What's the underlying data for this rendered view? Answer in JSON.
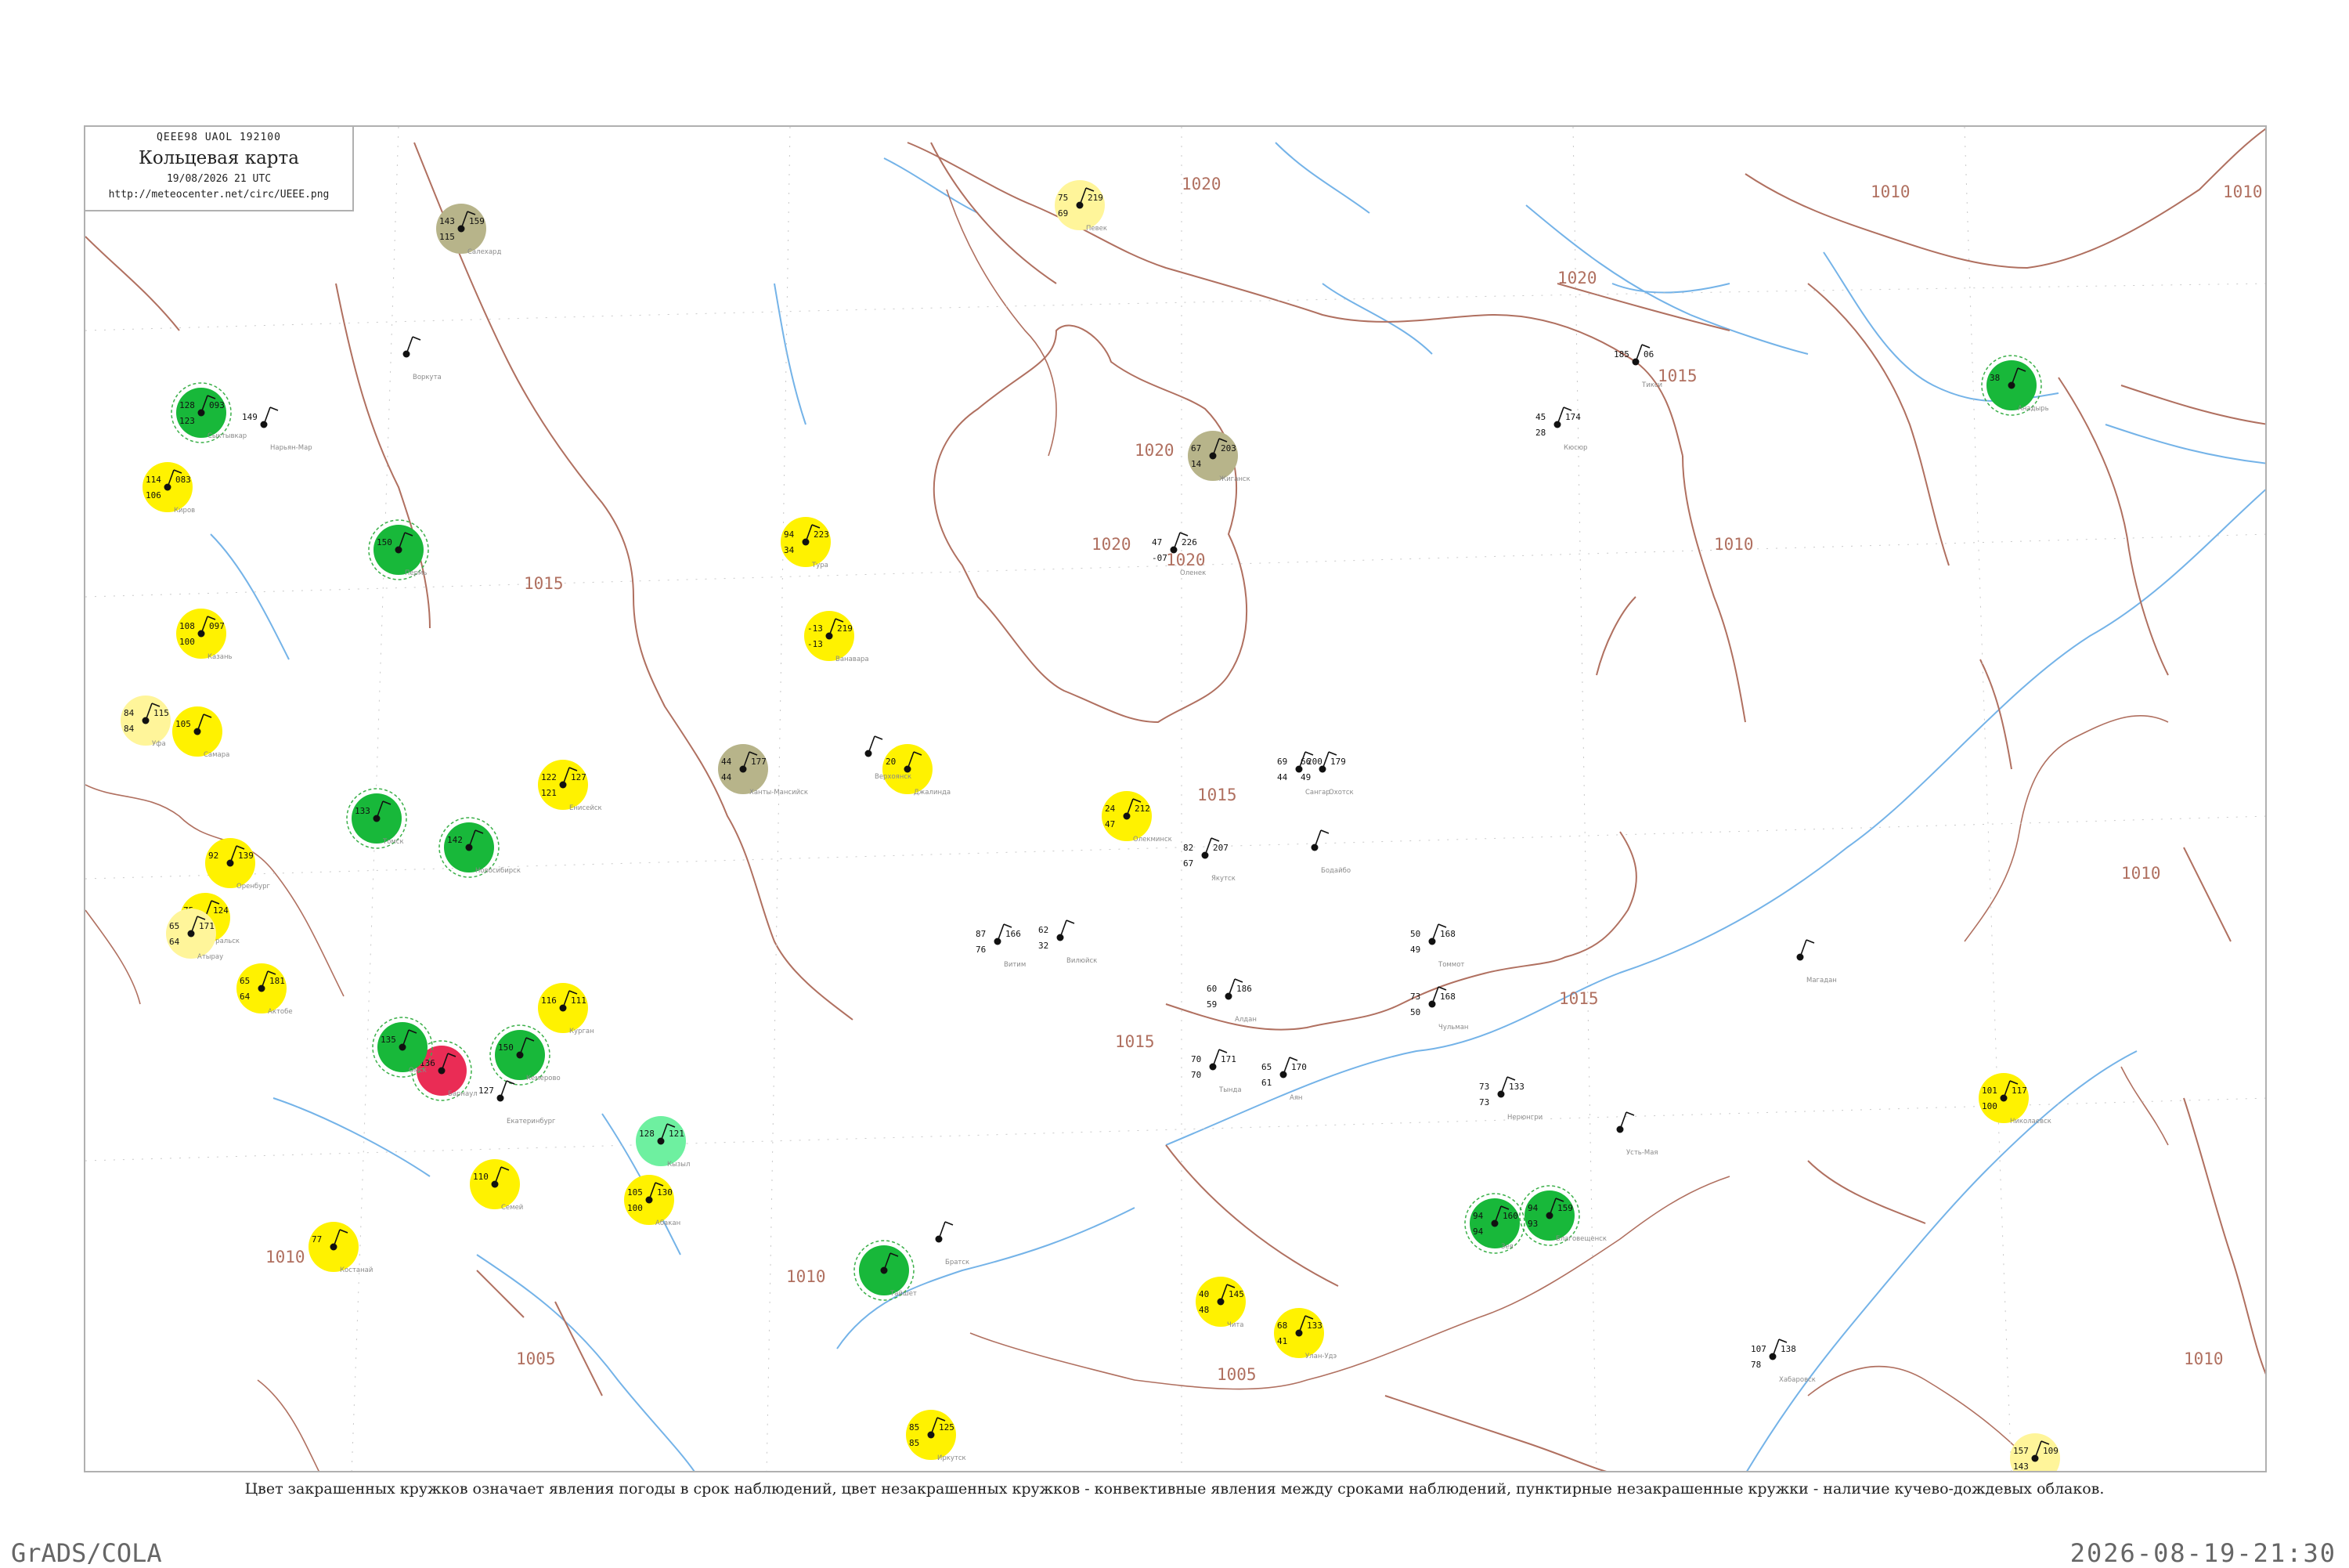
{
  "header": {
    "bulletin_code": "QEEE98  UAOL  192100",
    "title": "Кольцевая карта",
    "datetime": "19/08/2026 21 UTC",
    "url": "http://meteocenter.net/circ/UEEE.png"
  },
  "footnote": "Цвет закрашенных кружков означает явления погоды в срок наблюдений, цвет незакрашенных кружков - конвективные явления между сроками наблюдений, пунктирные незакрашенные кружки - наличие кучево-дождевых облаков.",
  "software_label": "GrADS/COLA",
  "timestamp": "2026-08-19-21:30",
  "colors": {
    "frame": "#b0b0b0",
    "isobar": "#b07060",
    "river": "#74b3e8",
    "thunder": "#18b83a",
    "rain": "#fff200",
    "drizzle": "#fff59a",
    "fog": "#b7b48a",
    "storm": "#ea2c55",
    "shower": "#6ef0a0",
    "cb_ring": "#3cb04a"
  },
  "isobar_labels": [
    "1020",
    "1020",
    "1020",
    "1020",
    "1020",
    "1015",
    "1015",
    "1015",
    "1015",
    "1015",
    "1010",
    "1010",
    "1010",
    "1010",
    "1010",
    "1010",
    "1010",
    "1005",
    "1005"
  ],
  "stations": [
    {
      "name": "Тикси",
      "t": "185",
      "td": "06",
      "p": "",
      "phen": "none"
    },
    {
      "name": "Кюсюр",
      "t": "45",
      "td": "174",
      "p": "28",
      "phen": "none"
    },
    {
      "name": "Джалинда",
      "t": "20",
      "td": "",
      "p": "",
      "phen": "rain"
    },
    {
      "name": "Оленек",
      "t": "47",
      "td": "226",
      "p": "-07",
      "phen": "none"
    },
    {
      "name": "Жиганск",
      "t": "67",
      "td": "203",
      "p": "14",
      "phen": "fog"
    },
    {
      "name": "Сангар",
      "t": "69",
      "td": "200",
      "p": "44",
      "phen": "none"
    },
    {
      "name": "Якутск",
      "t": "82",
      "td": "207",
      "p": "67",
      "phen": "none"
    },
    {
      "name": "Вилюйск",
      "t": "62",
      "td": "",
      "p": "32",
      "phen": "none"
    },
    {
      "name": "Витим",
      "t": "87",
      "td": "166",
      "p": "76",
      "phen": "none"
    },
    {
      "name": "Олекминск",
      "t": "24",
      "td": "212",
      "p": "47",
      "phen": "rain"
    },
    {
      "name": "Алдан",
      "t": "60",
      "td": "186",
      "p": "59",
      "phen": "none"
    },
    {
      "name": "Томмот",
      "t": "50",
      "td": "168",
      "p": "49",
      "phen": "none"
    },
    {
      "name": "Охотск",
      "t": "66",
      "td": "179",
      "p": "49",
      "phen": "none"
    },
    {
      "name": "Аян",
      "t": "65",
      "td": "170",
      "p": "61",
      "phen": "none"
    },
    {
      "name": "Чульман",
      "t": "73",
      "td": "168",
      "p": "50",
      "phen": "none"
    },
    {
      "name": "Тында",
      "t": "70",
      "td": "171",
      "p": "70",
      "phen": "none"
    },
    {
      "name": "Зея",
      "t": "94",
      "td": "160",
      "p": "94",
      "phen": "thunder"
    },
    {
      "name": "Благовещенск",
      "t": "94",
      "td": "159",
      "p": "93",
      "phen": "thunder"
    },
    {
      "name": "Хабаровск",
      "t": "107",
      "td": "138",
      "p": "78",
      "phen": "none"
    },
    {
      "name": "Николаевск",
      "t": "101",
      "td": "117",
      "p": "100",
      "phen": "rain"
    },
    {
      "name": "Владивосток",
      "t": "157",
      "td": "109",
      "p": "143",
      "phen": "drizzle"
    },
    {
      "name": "Анадырь",
      "t": "38",
      "td": "",
      "p": "",
      "phen": "thunder"
    },
    {
      "name": "Певек",
      "t": "75",
      "td": "219",
      "p": "69",
      "phen": "drizzle"
    },
    {
      "name": "Салехард",
      "t": "143",
      "td": "159",
      "p": "115",
      "phen": "fog"
    },
    {
      "name": "Ханты-Мансийск",
      "t": "44",
      "td": "177",
      "p": "44",
      "phen": "fog"
    },
    {
      "name": "Тура",
      "t": "94",
      "td": "223",
      "p": "34",
      "phen": "rain"
    },
    {
      "name": "Ванавара",
      "t": "-13",
      "td": "219",
      "p": "-13",
      "phen": "rain"
    },
    {
      "name": "Енисейск",
      "t": "122",
      "td": "127",
      "p": "121",
      "phen": "rain"
    },
    {
      "name": "Томск",
      "t": "133",
      "td": "",
      "p": "",
      "phen": "thunder"
    },
    {
      "name": "Новосибирск",
      "t": "142",
      "td": "",
      "p": "",
      "phen": "thunder"
    },
    {
      "name": "Барнаул",
      "t": "136",
      "td": "",
      "p": "",
      "phen": "storm"
    },
    {
      "name": "Кемерово",
      "t": "150",
      "td": "",
      "p": "",
      "phen": "thunder"
    },
    {
      "name": "Иркутск",
      "t": "85",
      "td": "125",
      "p": "85",
      "phen": "rain"
    },
    {
      "name": "Улан-Удэ",
      "t": "68",
      "td": "133",
      "p": "41",
      "phen": "rain"
    },
    {
      "name": "Чита",
      "t": "40",
      "td": "145",
      "p": "48",
      "phen": "rain"
    },
    {
      "name": "Кызыл",
      "t": "128",
      "td": "121",
      "p": "",
      "phen": "shower"
    },
    {
      "name": "Абакан",
      "t": "105",
      "td": "130",
      "p": "100",
      "phen": "rain"
    },
    {
      "name": "Омск",
      "t": "135",
      "td": "",
      "p": "",
      "phen": "thunder"
    },
    {
      "name": "Курган",
      "t": "116",
      "td": "111",
      "p": "",
      "phen": "rain"
    },
    {
      "name": "Екатеринбург",
      "t": "127",
      "td": "",
      "p": "",
      "phen": "none"
    },
    {
      "name": "Пермь",
      "t": "150",
      "td": "",
      "p": "",
      "phen": "thunder"
    },
    {
      "name": "Сыктывкар",
      "t": "128",
      "td": "093",
      "p": "123",
      "phen": "thunder"
    },
    {
      "name": "Нарьян-Мар",
      "t": "149",
      "td": "",
      "p": "",
      "phen": "none"
    },
    {
      "name": "Воркута",
      "t": "",
      "td": "",
      "p": "",
      "phen": "none"
    },
    {
      "name": "Киров",
      "t": "114",
      "td": "083",
      "p": "106",
      "phen": "rain"
    },
    {
      "name": "Казань",
      "t": "108",
      "td": "097",
      "p": "100",
      "phen": "rain"
    },
    {
      "name": "Самара",
      "t": "105",
      "td": "",
      "p": "",
      "phen": "rain"
    },
    {
      "name": "Оренбург",
      "t": "92",
      "td": "139",
      "p": "",
      "phen": "rain"
    },
    {
      "name": "Уральск",
      "t": "75",
      "td": "124",
      "p": "75",
      "phen": "rain"
    },
    {
      "name": "Уфа",
      "t": "84",
      "td": "115",
      "p": "84",
      "phen": "drizzle"
    },
    {
      "name": "Актобе",
      "t": "65",
      "td": "181",
      "p": "64",
      "phen": "rain"
    },
    {
      "name": "Атырау",
      "t": "65",
      "td": "171",
      "p": "64",
      "phen": "drizzle"
    },
    {
      "name": "Костанай",
      "t": "77",
      "td": "",
      "p": "",
      "phen": "rain"
    },
    {
      "name": "Семей",
      "t": "110",
      "td": "",
      "p": "",
      "phen": "rain"
    },
    {
      "name": "Тайшет",
      "t": "",
      "td": "",
      "p": "",
      "phen": "thunder"
    },
    {
      "name": "Братск",
      "t": "",
      "td": "",
      "p": "",
      "phen": "none"
    },
    {
      "name": "Бодайбо",
      "t": "",
      "td": "",
      "p": "",
      "phen": "none"
    },
    {
      "name": "Нерюнгри",
      "t": "73",
      "td": "133",
      "p": "73",
      "phen": "none"
    },
    {
      "name": "Усть-Мая",
      "t": "",
      "td": "",
      "p": "",
      "phen": "none"
    },
    {
      "name": "Верхоянск",
      "t": "",
      "td": "",
      "p": "",
      "phen": "none"
    },
    {
      "name": "Магадан",
      "t": "",
      "td": "",
      "p": "",
      "phen": "none"
    }
  ]
}
